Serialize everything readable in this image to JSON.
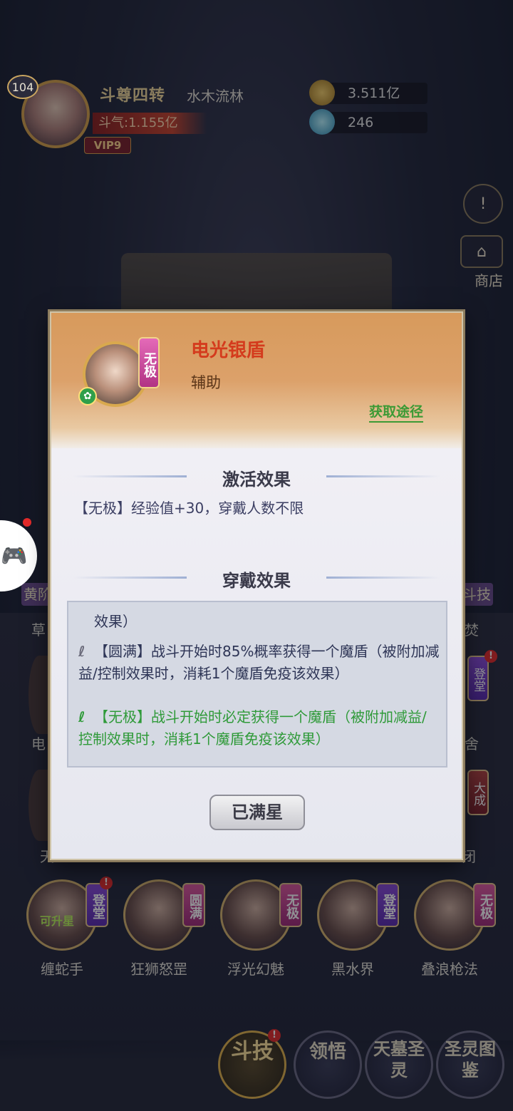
{
  "player": {
    "level": "104",
    "rank": "斗尊四转",
    "name": "水木流林",
    "power": "斗气:1.155亿",
    "vip": "VIP9"
  },
  "resources": {
    "gold": "3.511亿",
    "gems": "246"
  },
  "side": {
    "alert_icon": "!",
    "shop_label": "商店"
  },
  "grid_row_bottom": [
    {
      "name": "缠蛇手",
      "tag": "登堂",
      "upgradable": "可升星"
    },
    {
      "name": "狂狮怒罡",
      "tag": "圆满"
    },
    {
      "name": "浮光幻魅",
      "tag": "无极"
    },
    {
      "name": "黑水界",
      "tag": "登堂"
    },
    {
      "name": "叠浪枪法",
      "tag": "无极"
    }
  ],
  "grid_side": {
    "left_tab": "黄阶",
    "left_partial_1": "草",
    "left_partial_2": "电",
    "left_partial_3": "天",
    "right_tab": "斗技",
    "right_partial_1": "焚",
    "right_tag_1": "登堂",
    "right_partial_2": "舍",
    "right_tag_2": "大成",
    "right_partial_3": "闭"
  },
  "bottom_nav": [
    {
      "label": "斗技"
    },
    {
      "label": "领悟"
    },
    {
      "label": "天墓圣灵"
    },
    {
      "label": "圣灵图鉴"
    }
  ],
  "modal": {
    "hero_tag": "无极",
    "skill_title": "电光银盾",
    "skill_type": "辅助",
    "source_link": "获取途径",
    "activation_title": "激活效果",
    "activation_text": "【无极】经验值+30，穿戴人数不限",
    "wear_title": "穿戴效果",
    "effects": [
      {
        "text": "效果）",
        "highlight": false
      },
      {
        "text": "【圆满】战斗开始时85%概率获得一个魔盾（被附加减益/控制效果时，消耗1个魔盾免疫该效果）",
        "highlight": false
      },
      {
        "text": "【无极】战斗开始时必定获得一个魔盾（被附加减益/控制效果时，消耗1个魔盾免疫该效果）",
        "highlight": true
      }
    ],
    "max_star_button": "已满星"
  },
  "colors": {
    "title_red": "#d43b1d",
    "green": "#2f9a39",
    "gold": "#d9a94e"
  }
}
